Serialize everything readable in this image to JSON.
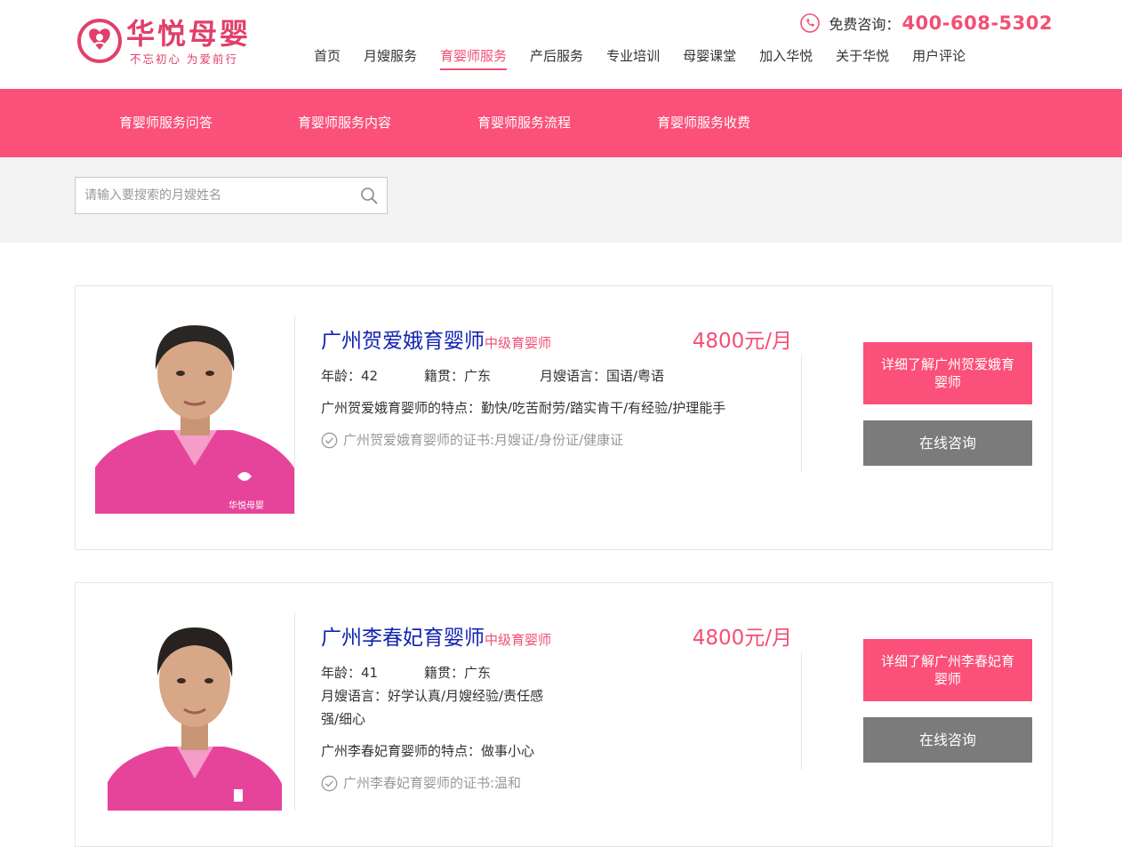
{
  "brand": {
    "name": "华悦母婴",
    "slogan": "不忘初心 为爱前行",
    "accent_color": "#f24f74",
    "subnav_color": "#fb5079",
    "logo_icon": "heart-mother-baby-logo-icon"
  },
  "hotline": {
    "label": "免费咨询：",
    "number": "400-608-5302",
    "icon": "phone-icon"
  },
  "nav": {
    "items": [
      {
        "label": "首页",
        "active": false
      },
      {
        "label": "月嫂服务",
        "active": false
      },
      {
        "label": "育婴师服务",
        "active": true
      },
      {
        "label": "产后服务",
        "active": false
      },
      {
        "label": "专业培训",
        "active": false
      },
      {
        "label": "母婴课堂",
        "active": false
      },
      {
        "label": "加入华悦",
        "active": false
      },
      {
        "label": "关于华悦",
        "active": false
      },
      {
        "label": "用户评论",
        "active": false
      }
    ]
  },
  "subnav": {
    "items": [
      {
        "label": "育婴师服务问答"
      },
      {
        "label": "育婴师服务内容"
      },
      {
        "label": "育婴师服务流程"
      },
      {
        "label": "育婴师服务收费"
      }
    ]
  },
  "search": {
    "placeholder": "请输入要搜索的月嫂姓名",
    "value": "",
    "icon": "search-icon"
  },
  "cards": [
    {
      "name": "广州贺爱娥育婴师",
      "level": "中级育婴师",
      "price": "4800元/月",
      "age": "年龄：42",
      "origin": "籍贯：广东",
      "language": "月嫂语言：国语/粤语",
      "language_cont": "",
      "features": "广州贺爱娥育婴师的特点：勤快/吃苦耐劳/踏实肯干/有经验/护理能手",
      "certs": "广州贺爱娥育婴师的证书:月嫂证/身份证/健康证",
      "detail_label": "详细了解广州贺爱娥育婴师",
      "consult_label": "在线咨询"
    },
    {
      "name": "广州李春妃育婴师",
      "level": "中级育婴师",
      "price": "4800元/月",
      "age": "年龄：41",
      "origin": "籍贯：广东",
      "language": "月嫂语言：好学认真/月嫂经验/责任感",
      "language_cont": "强/细心",
      "features": "广州李春妃育婴师的特点：做事小心",
      "certs": "广州李春妃育婴师的证书:温和",
      "detail_label": "详细了解广州李春妃育婴师",
      "consult_label": "在线咨询"
    }
  ]
}
